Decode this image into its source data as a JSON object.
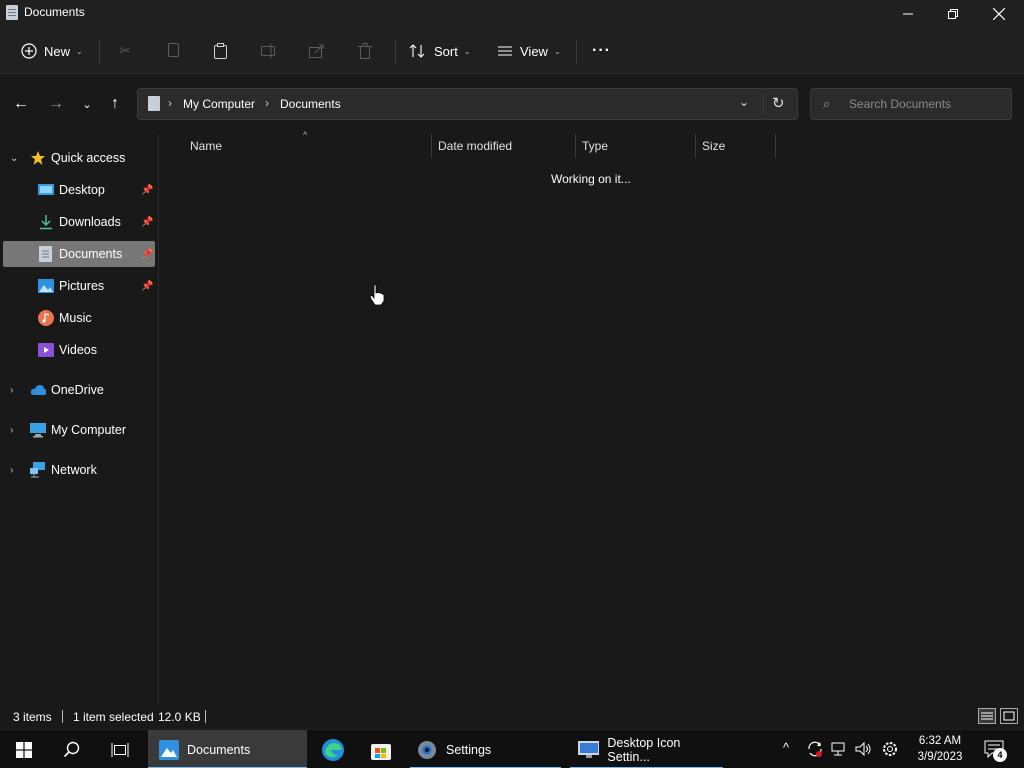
{
  "window": {
    "title": "Documents"
  },
  "toolbar": {
    "new_label": "New",
    "sort_label": "Sort",
    "view_label": "View",
    "more_label": "···"
  },
  "address": {
    "crumbs": [
      "My Computer",
      "Documents"
    ],
    "search_placeholder": "Search Documents"
  },
  "sidebar": {
    "items": [
      {
        "label": "Quick access",
        "icon": "star-icon"
      },
      {
        "label": "Desktop",
        "icon": "desktop-folder-icon",
        "pinned": true
      },
      {
        "label": "Downloads",
        "icon": "download-icon",
        "pinned": true
      },
      {
        "label": "Documents",
        "icon": "documents-icon",
        "pinned": true,
        "selected": true
      },
      {
        "label": "Pictures",
        "icon": "pictures-icon",
        "pinned": true
      },
      {
        "label": "Music",
        "icon": "music-icon"
      },
      {
        "label": "Videos",
        "icon": "videos-icon"
      },
      {
        "label": "OneDrive",
        "icon": "cloud-icon"
      },
      {
        "label": "My Computer",
        "icon": "computer-icon"
      },
      {
        "label": "Network",
        "icon": "network-icon"
      }
    ]
  },
  "content": {
    "columns": [
      "Name",
      "Date modified",
      "Type",
      "Size"
    ],
    "status_message": "Working on it..."
  },
  "statusbar": {
    "item_count": "3 items",
    "selection": "1 item selected",
    "size": "12.0 KB"
  },
  "taskbar": {
    "apps": [
      {
        "label": "Documents",
        "icon": "file-explorer-icon"
      },
      {
        "label": "Settings",
        "icon": "settings-gear-icon"
      },
      {
        "label": "Desktop Icon Settin...",
        "icon": "desktop-icon-settings-icon"
      }
    ],
    "clock_time": "6:32 AM",
    "clock_date": "3/9/2023",
    "notification_count": "4"
  },
  "colors": {
    "background": "#191919",
    "chrome": "#202020",
    "selection": "#777777",
    "accent": "#76b9ed"
  }
}
